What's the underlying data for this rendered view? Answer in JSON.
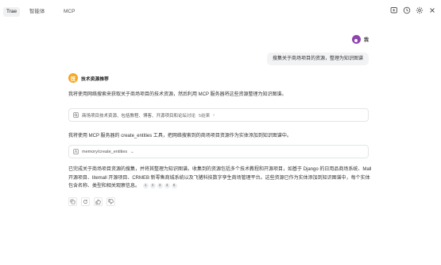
{
  "tabs": [
    {
      "label": "Trae",
      "active": true
    },
    {
      "label": "智能体",
      "active": false
    },
    {
      "label": "MCP",
      "active": false
    }
  ],
  "top_icons": [
    "add-chat-icon",
    "history-icon",
    "settings-icon",
    "close-icon"
  ],
  "user": {
    "name": "我",
    "message": "搜集关于商场项目的资源，整理为知识图谱",
    "avatar_color": "#8e44ad"
  },
  "assistant": {
    "name": "技术资源推荐",
    "avatar_char": "技",
    "avatar_color": "#f5a623",
    "intro": "我将使用网络搜索来获取关于商场项目的技术资源，然后利用 MCP 服务器将这些资源整理为知识图谱。",
    "search_tool": {
      "icon": "web-search-icon",
      "text": "商场项目技术资源、包括教程、博客、开源项目和论坛讨论",
      "results": "5结果",
      "chevron": "›"
    },
    "mid": "我将使用 MCP 服务器的 create_entities 工具，把网络搜索到的商场项目资源作为实体添加到知识图谱中。",
    "mcp_tool": {
      "icon": "tool-icon",
      "text": "memory/create_entities",
      "chevron": "⌄"
    },
    "final": "已完成关于商场项目资源的搜集，并将其整理为知识图谱。收集到的资源包括多个技术教程和开源项目，如基于 Django 的日用品商场系统、Mall 开源项目、litemall 开源项目、CRMEB 新零售商城系统以及飞猪科技数字孪生商场管理平台。这些资源已作为实体添加到知识图谱中，每个实体包含名称、类型和相关观察信息。",
    "citations": [
      "1",
      "2",
      "3",
      "4",
      "5"
    ]
  },
  "action_icons": [
    "copy-icon",
    "refresh-icon",
    "thumbs-up-icon",
    "thumbs-down-icon"
  ]
}
